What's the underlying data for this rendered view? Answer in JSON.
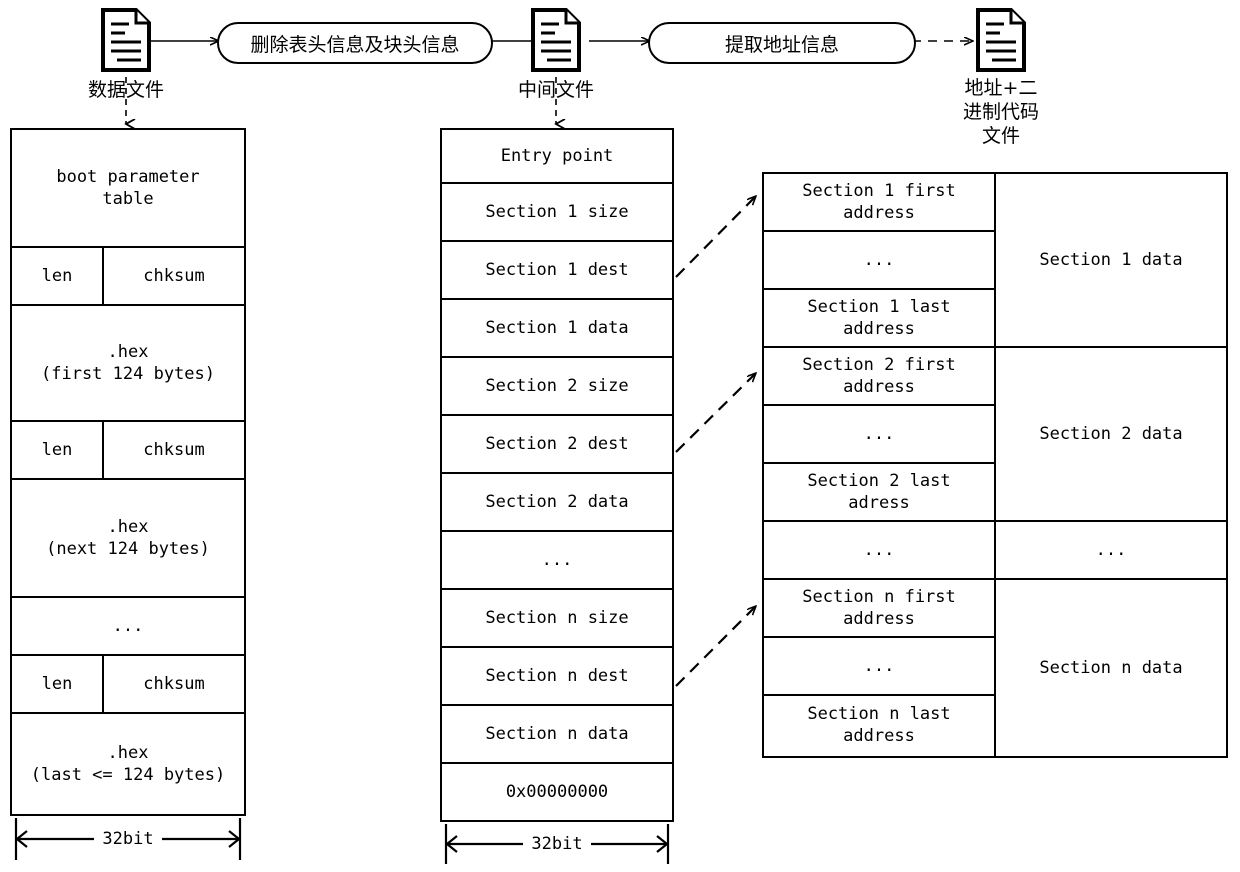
{
  "flow": {
    "source_file": {
      "icon": "document-icon",
      "label": "数据文件"
    },
    "step1": {
      "label": "删除表头信息及块头信息"
    },
    "intermediate_file": {
      "icon": "document-icon",
      "label": "中间文件"
    },
    "step2": {
      "label": "提取地址信息"
    },
    "output_file": {
      "icon": "document-icon",
      "label": "地址+二\n进制代码\n文件"
    }
  },
  "data_file_table": {
    "width_label": "32bit",
    "rows": [
      {
        "type": "full",
        "text": "boot parameter\ntable"
      },
      {
        "type": "split",
        "left": "len",
        "right": "chksum"
      },
      {
        "type": "full",
        "text": ".hex\n(first 124 bytes)"
      },
      {
        "type": "split",
        "left": "len",
        "right": "chksum"
      },
      {
        "type": "full",
        "text": ".hex\n(next 124 bytes)"
      },
      {
        "type": "full",
        "text": "..."
      },
      {
        "type": "split",
        "left": "len",
        "right": "chksum"
      },
      {
        "type": "full",
        "text": ".hex\n(last <= 124 bytes)"
      }
    ]
  },
  "intermediate_file_table": {
    "width_label": "32bit",
    "rows": [
      {
        "text": "Entry point"
      },
      {
        "text": "Section 1 size"
      },
      {
        "text": "Section 1 dest"
      },
      {
        "text": "Section 1 data"
      },
      {
        "text": "Section 2 size"
      },
      {
        "text": "Section 2 dest"
      },
      {
        "text": "Section 2 data"
      },
      {
        "text": "..."
      },
      {
        "text": "Section n size"
      },
      {
        "text": "Section n dest"
      },
      {
        "text": "Section n data"
      },
      {
        "text": "0x00000000"
      }
    ]
  },
  "address_table": {
    "address_rows": [
      {
        "text": "Section 1 first\naddress"
      },
      {
        "text": "..."
      },
      {
        "text": "Section 1 last\naddress"
      },
      {
        "text": "Section 2 first\naddress"
      },
      {
        "text": "..."
      },
      {
        "text": "Section 2 last\nadress"
      },
      {
        "text": "..."
      },
      {
        "text": "Section n first\naddress"
      },
      {
        "text": "..."
      },
      {
        "text": "Section n last\naddress"
      }
    ],
    "data_rows": [
      {
        "text": "Section 1 data"
      },
      {
        "text": "Section 2 data"
      },
      {
        "text": "..."
      },
      {
        "text": "Section n data"
      }
    ]
  },
  "colors": {
    "stroke": "#000000",
    "background": "#ffffff"
  }
}
